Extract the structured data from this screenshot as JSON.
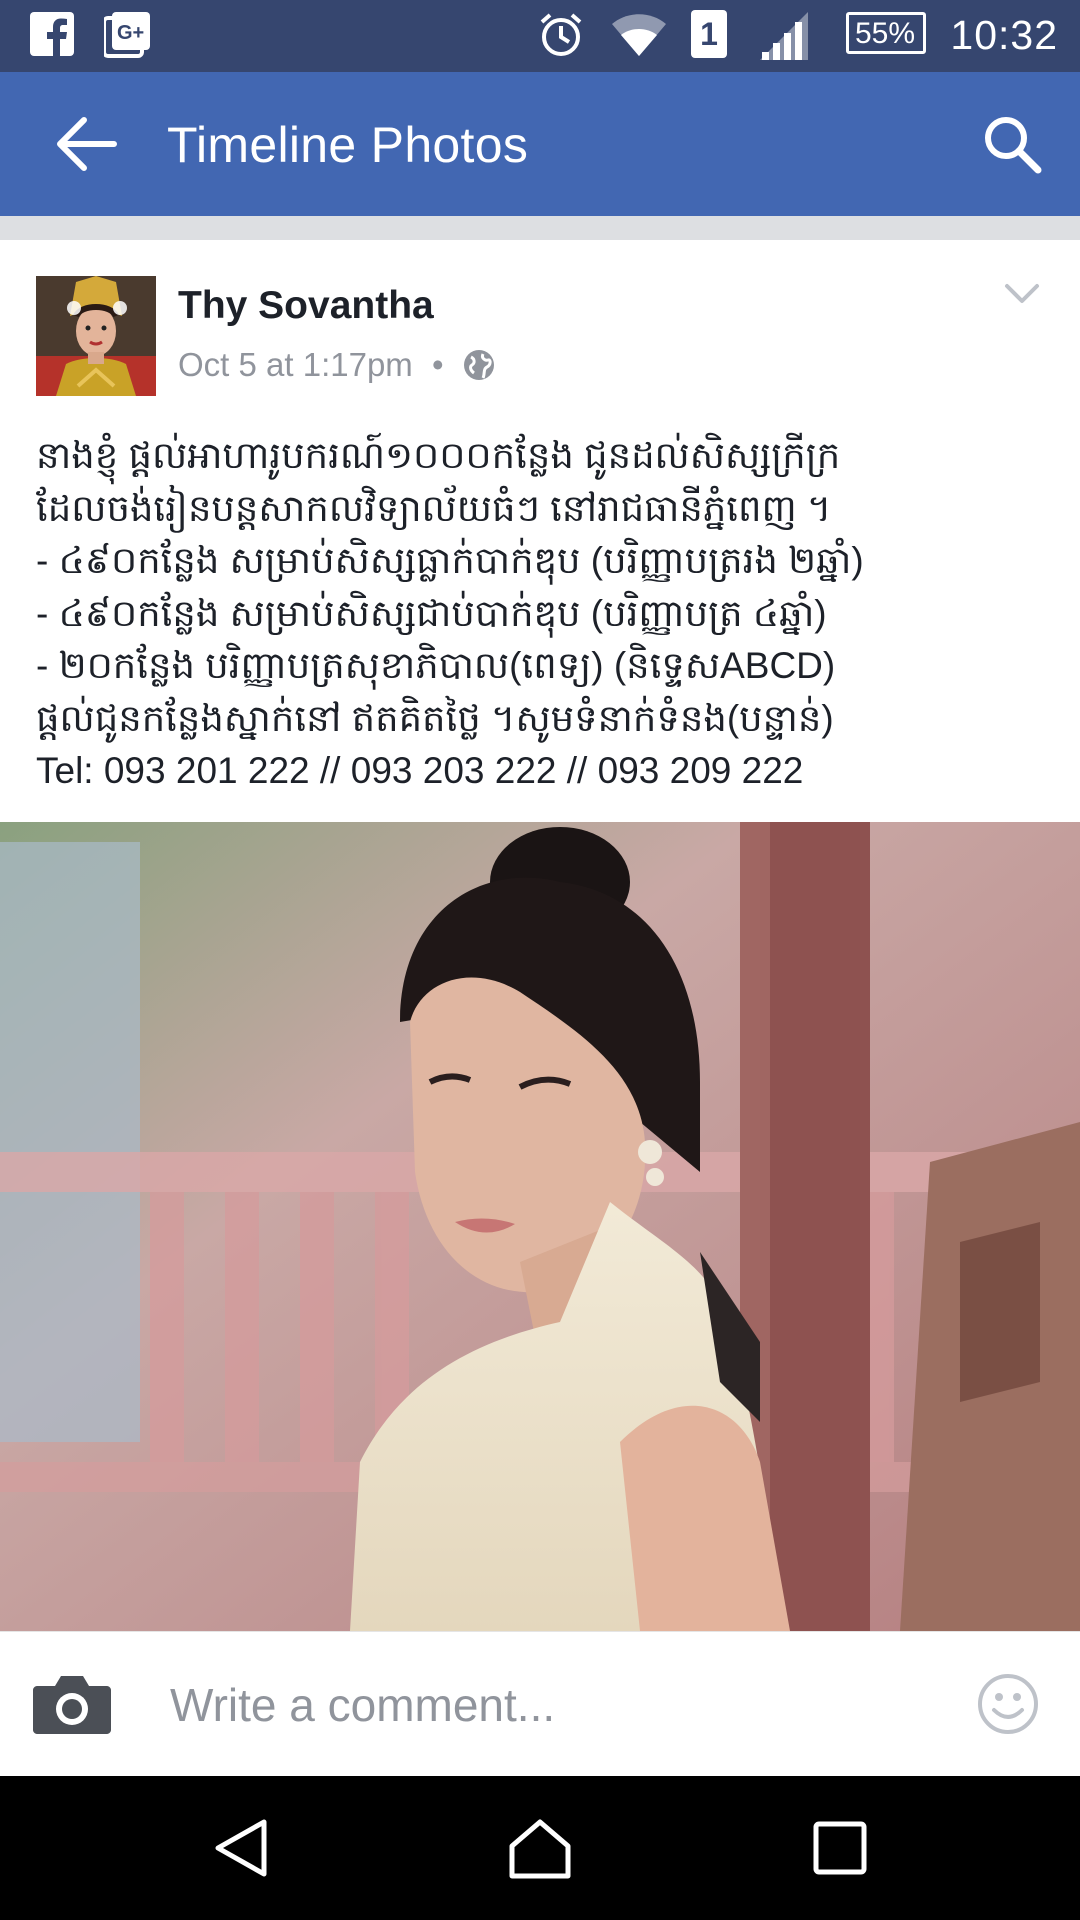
{
  "status_bar": {
    "time": "10:32",
    "battery": "55%",
    "sim_slot": "1",
    "icons": [
      "facebook-icon",
      "google-plus-icon",
      "alarm-icon",
      "wifi-icon",
      "sim-icon",
      "signal-icon",
      "battery-icon"
    ]
  },
  "app_bar": {
    "title": "Timeline Photos",
    "icons": [
      "back-arrow-icon",
      "search-icon"
    ]
  },
  "post": {
    "author": "Thy Sovantha",
    "timestamp": "Oct 5 at 1:17pm",
    "separator": "•",
    "audience_icon": "globe-icon",
    "text_lines": [
      "នាងខ្ញុំ ផ្តល់អាហារូបករណ៍១០០០កន្លែង ជូនដល់សិស្សក្រីក្រ",
      "ដែលចង់រៀនបន្តសាកលវិទ្យាល័យធំៗ នៅរាជធានីភ្នំពេញ ។",
      "- ៤៩០កន្លែង សម្រាប់សិស្សធ្លាក់បាក់ឌុប (បរិញ្ញាបត្ររង ២ឆ្នាំ)",
      "- ៤៩០កន្លែង សម្រាប់សិស្សជាប់បាក់ឌុប (បរិញ្ញាបត្រ ៤ឆ្នាំ)",
      "- ២០កន្លែង បរិញ្ញាបត្រសុខាភិបាល(ពេទ្យ) (និទ្ទេសABCD)",
      "ផ្តល់ជូនកន្លែងស្នាក់នៅ ឥតគិតថ្លៃ ។សូមទំនាក់ទំនង(បន្ទាន់)",
      "Tel: 093 201 222 // 093 203 222 // 093 209 222"
    ]
  },
  "comment_bar": {
    "placeholder": "Write a comment...",
    "icons": [
      "camera-icon",
      "smiley-icon"
    ]
  },
  "nav_bar": {
    "icons": [
      "nav-back-icon",
      "nav-home-icon",
      "nav-recents-icon"
    ]
  },
  "colors": {
    "status_bar": "#36466f",
    "app_bar": "#4267b2",
    "text": "#1d2129",
    "secondary_text": "#90949c",
    "separator_band": "#dddfe2"
  }
}
